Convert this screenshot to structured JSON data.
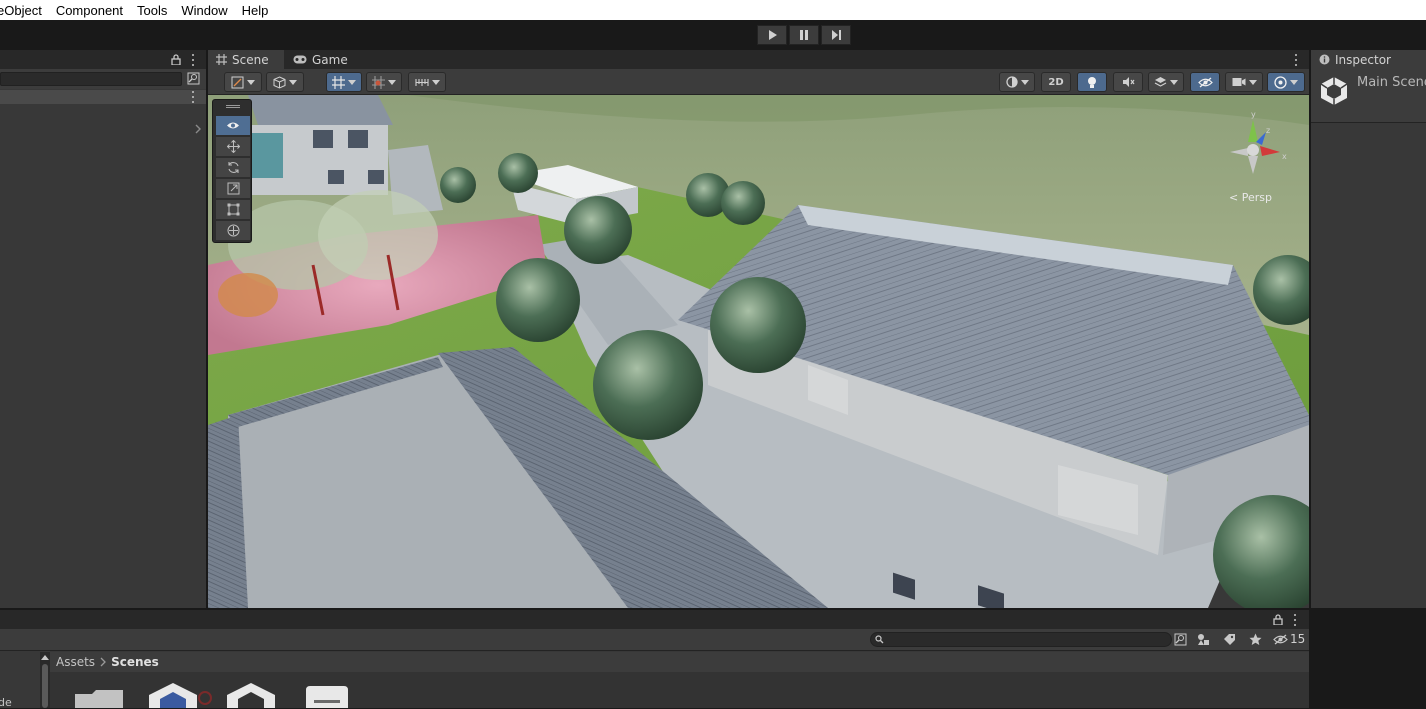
{
  "menu": [
    "eObject",
    "Component",
    "Tools",
    "Window",
    "Help"
  ],
  "play_controls": [
    {
      "name": "play",
      "icon": "play-icon"
    },
    {
      "name": "pause",
      "icon": "pause-icon"
    },
    {
      "name": "step",
      "icon": "step-icon"
    }
  ],
  "scene_panel": {
    "tabs": [
      {
        "label": "Scene",
        "icon": "grid-icon",
        "active": true
      },
      {
        "label": "Game",
        "icon": "gamepad-icon",
        "active": false
      }
    ],
    "toggle_2d": "2D",
    "gizmo": {
      "y_axis": "y",
      "x_axis": "x",
      "z_axis": "z",
      "projection": "< Persp"
    }
  },
  "tool_panel": [
    "view-tool",
    "move-tool",
    "rotate-tool",
    "scale-tool",
    "rect-tool",
    "transform-tool"
  ],
  "inspector": {
    "tab_label": "Inspector",
    "object_name": "Main Scene"
  },
  "project": {
    "breadcrumb": [
      "Assets",
      "Scenes"
    ],
    "hidden_count": "15",
    "left_item": "de"
  },
  "colors": {
    "accent_blue": "#4d6a8e",
    "panel": "#383838",
    "tabbar": "#282828"
  }
}
